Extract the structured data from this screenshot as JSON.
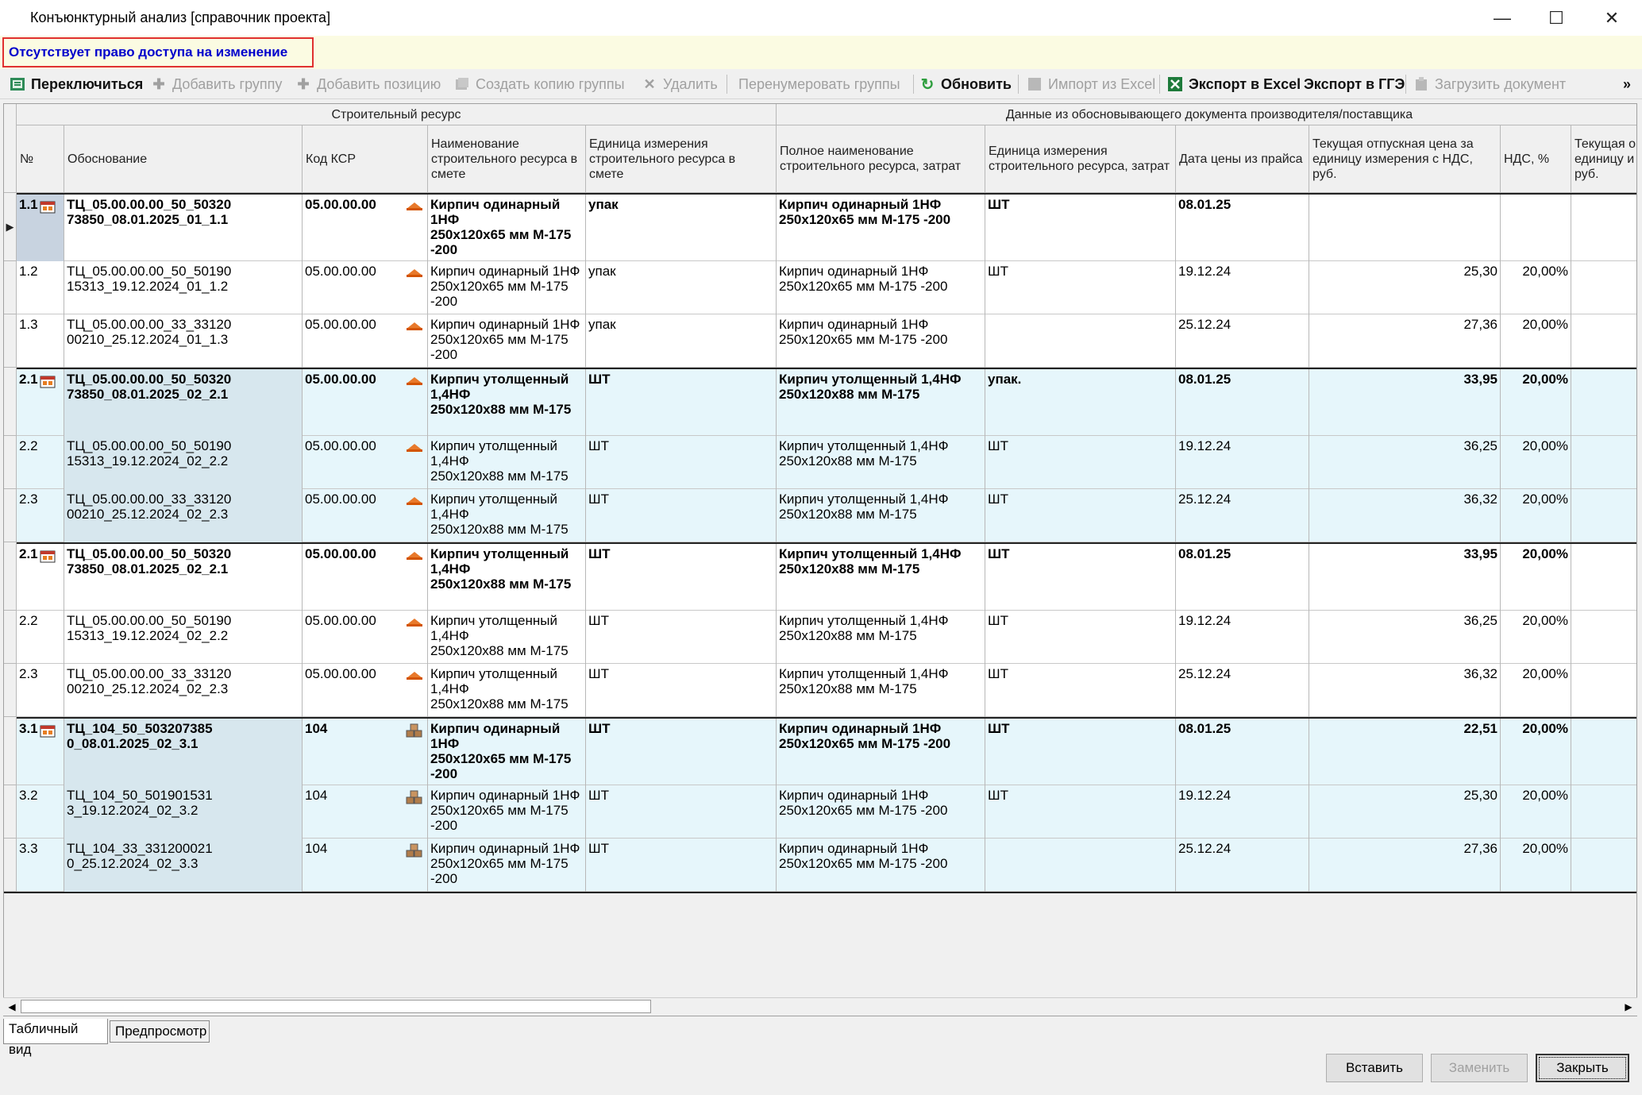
{
  "window": {
    "title": "Конъюнктурный анализ [справочник проекта]",
    "minimize": "—",
    "maximize": "☐",
    "close": "✕"
  },
  "warning": "Отсутствует право доступа на изменение",
  "toolbar": {
    "switch": "Переключиться",
    "add_group": "Добавить группу",
    "add_position": "Добавить позицию",
    "copy_group": "Создать копию группы",
    "delete": "Удалить",
    "renumber": "Перенумеровать группы",
    "refresh": "Обновить",
    "import_excel": "Импорт из Excel",
    "export_excel": "Экспорт в Excel",
    "export_gge": "Экспорт в ГГЭ",
    "load_doc": "Загрузить документ",
    "more": "»"
  },
  "grid": {
    "group_headers": {
      "resource": "Строительный ресурс",
      "supplier": "Данные из обосновывающего документа производителя/поставщика"
    },
    "columns": {
      "num": "№",
      "basis": "Обоснование",
      "ksr": "Код КСР",
      "name": "Наименование строительного ресурса в смете",
      "unit": "Единица измерения строительного ресурса в смете",
      "full_name": "Полное наименование строительного ресурса, затрат",
      "unit2": "Единица измерения строительного ресурса, затрат",
      "date": "Дата цены из прайса",
      "price": "Текущая отпускная цена за единицу измерения с НДС, руб.",
      "vat": "НДС, %",
      "price2": "Текущая о единицу и руб."
    },
    "rows": [
      {
        "num": "1.1",
        "basis": "ТЦ_05.00.00.00_50_50320\n73850_08.01.2025_01_1.1",
        "ksr": "05.00.00.00",
        "name": "Кирпич одинарный 1НФ\n250х120х65 мм М-175\n-200",
        "unit": "упак",
        "full_name": "Кирпич одинарный 1НФ\n250х120х65 мм М-175 -200",
        "unit2": "ШТ",
        "date": "08.01.25",
        "price": "",
        "vat": "",
        "bold": true,
        "icon": "brick"
      },
      {
        "num": "1.2",
        "basis": "ТЦ_05.00.00.00_50_50190\n15313_19.12.2024_01_1.2",
        "ksr": "05.00.00.00",
        "name": "Кирпич одинарный 1НФ\n250х120х65 мм М-175\n-200",
        "unit": "упак",
        "full_name": "Кирпич одинарный 1НФ\n250х120х65 мм М-175 -200",
        "unit2": "ШТ",
        "date": "19.12.24",
        "price": "25,30",
        "vat": "20,00%",
        "bold": false,
        "icon": "brick"
      },
      {
        "num": "1.3",
        "basis": "ТЦ_05.00.00.00_33_33120\n00210_25.12.2024_01_1.3",
        "ksr": "05.00.00.00",
        "name": "Кирпич одинарный 1НФ\n250х120х65 мм М-175\n-200",
        "unit": "упак",
        "full_name": "Кирпич одинарный 1НФ\n250х120х65 мм М-175 -200",
        "unit2": "",
        "date": "25.12.24",
        "price": "27,36",
        "vat": "20,00%",
        "bold": false,
        "icon": "brick"
      },
      {
        "num": "2.1",
        "basis": "ТЦ_05.00.00.00_50_50320\n73850_08.01.2025_02_2.1",
        "ksr": "05.00.00.00",
        "name": "Кирпич утолщенный\n1,4НФ\n250х120х88 мм М-175",
        "unit": "ШТ",
        "full_name": "Кирпич утолщенный 1,4НФ\n250х120х88 мм М-175",
        "unit2": "упак.",
        "date": "08.01.25",
        "price": "33,95",
        "vat": "20,00%",
        "bold": true,
        "icon": "brick"
      },
      {
        "num": "2.2",
        "basis": "ТЦ_05.00.00.00_50_50190\n15313_19.12.2024_02_2.2",
        "ksr": "05.00.00.00",
        "name": "Кирпич утолщенный\n1,4НФ\n250х120х88 мм М-175",
        "unit": "ШТ",
        "full_name": "Кирпич утолщенный 1,4НФ\n250х120х88 мм М-175",
        "unit2": "ШТ",
        "date": "19.12.24",
        "price": "36,25",
        "vat": "20,00%",
        "bold": false,
        "icon": "brick"
      },
      {
        "num": "2.3",
        "basis": "ТЦ_05.00.00.00_33_33120\n00210_25.12.2024_02_2.3",
        "ksr": "05.00.00.00",
        "name": "Кирпич утолщенный\n1,4НФ\n250х120х88 мм М-175",
        "unit": "ШТ",
        "full_name": "Кирпич утолщенный 1,4НФ\n250х120х88 мм М-175",
        "unit2": "ШТ",
        "date": "25.12.24",
        "price": "36,32",
        "vat": "20,00%",
        "bold": false,
        "icon": "brick"
      },
      {
        "num": "2.1",
        "basis": "ТЦ_05.00.00.00_50_50320\n73850_08.01.2025_02_2.1",
        "ksr": "05.00.00.00",
        "name": "Кирпич утолщенный\n1,4НФ\n250х120х88 мм М-175",
        "unit": "ШТ",
        "full_name": "Кирпич утолщенный 1,4НФ\n250х120х88 мм М-175",
        "unit2": "ШТ",
        "date": "08.01.25",
        "price": "33,95",
        "vat": "20,00%",
        "bold": true,
        "icon": "brick"
      },
      {
        "num": "2.2",
        "basis": "ТЦ_05.00.00.00_50_50190\n15313_19.12.2024_02_2.2",
        "ksr": "05.00.00.00",
        "name": "Кирпич утолщенный\n1,4НФ\n250х120х88 мм М-175",
        "unit": "ШТ",
        "full_name": "Кирпич утолщенный 1,4НФ\n250х120х88 мм М-175",
        "unit2": "ШТ",
        "date": "19.12.24",
        "price": "36,25",
        "vat": "20,00%",
        "bold": false,
        "icon": "brick"
      },
      {
        "num": "2.3",
        "basis": "ТЦ_05.00.00.00_33_33120\n00210_25.12.2024_02_2.3",
        "ksr": "05.00.00.00",
        "name": "Кирпич утолщенный\n1,4НФ\n250х120х88 мм М-175",
        "unit": "ШТ",
        "full_name": "Кирпич утолщенный 1,4НФ\n250х120х88 мм М-175",
        "unit2": "ШТ",
        "date": "25.12.24",
        "price": "36,32",
        "vat": "20,00%",
        "bold": false,
        "icon": "brick"
      },
      {
        "num": "3.1",
        "basis": "ТЦ_104_50_503207385\n0_08.01.2025_02_3.1",
        "ksr": "104",
        "name": "Кирпич одинарный\n1НФ\n250х120х65 мм М-175\n-200",
        "unit": "ШТ",
        "full_name": "Кирпич одинарный 1НФ\n250х120х65 мм М-175 -200",
        "unit2": "ШТ",
        "date": "08.01.25",
        "price": "22,51",
        "vat": "20,00%",
        "bold": true,
        "icon": "blocks"
      },
      {
        "num": "3.2",
        "basis": "ТЦ_104_50_501901531\n3_19.12.2024_02_3.2",
        "ksr": "104",
        "name": "Кирпич одинарный 1НФ\n250х120х65 мм М-175\n-200",
        "unit": "ШТ",
        "full_name": "Кирпич одинарный 1НФ\n250х120х65 мм М-175 -200",
        "unit2": "ШТ",
        "date": "19.12.24",
        "price": "25,30",
        "vat": "20,00%",
        "bold": false,
        "icon": "blocks"
      },
      {
        "num": "3.3",
        "basis": "ТЦ_104_33_331200021\n0_25.12.2024_02_3.3",
        "ksr": "104",
        "name": "Кирпич одинарный 1НФ\n250х120х65 мм М-175\n-200",
        "unit": "ШТ",
        "full_name": "Кирпич одинарный 1НФ\n250х120х65 мм М-175 -200",
        "unit2": "",
        "date": "25.12.24",
        "price": "27,36",
        "vat": "20,00%",
        "bold": false,
        "icon": "blocks"
      }
    ]
  },
  "tabs": {
    "table": "Табличный вид",
    "preview": "Предпросмотр"
  },
  "buttons": {
    "insert": "Вставить",
    "replace": "Заменить",
    "close": "Закрыть"
  },
  "scroll": {
    "left": "◀",
    "right": "▶"
  },
  "row_indicator": "▶"
}
